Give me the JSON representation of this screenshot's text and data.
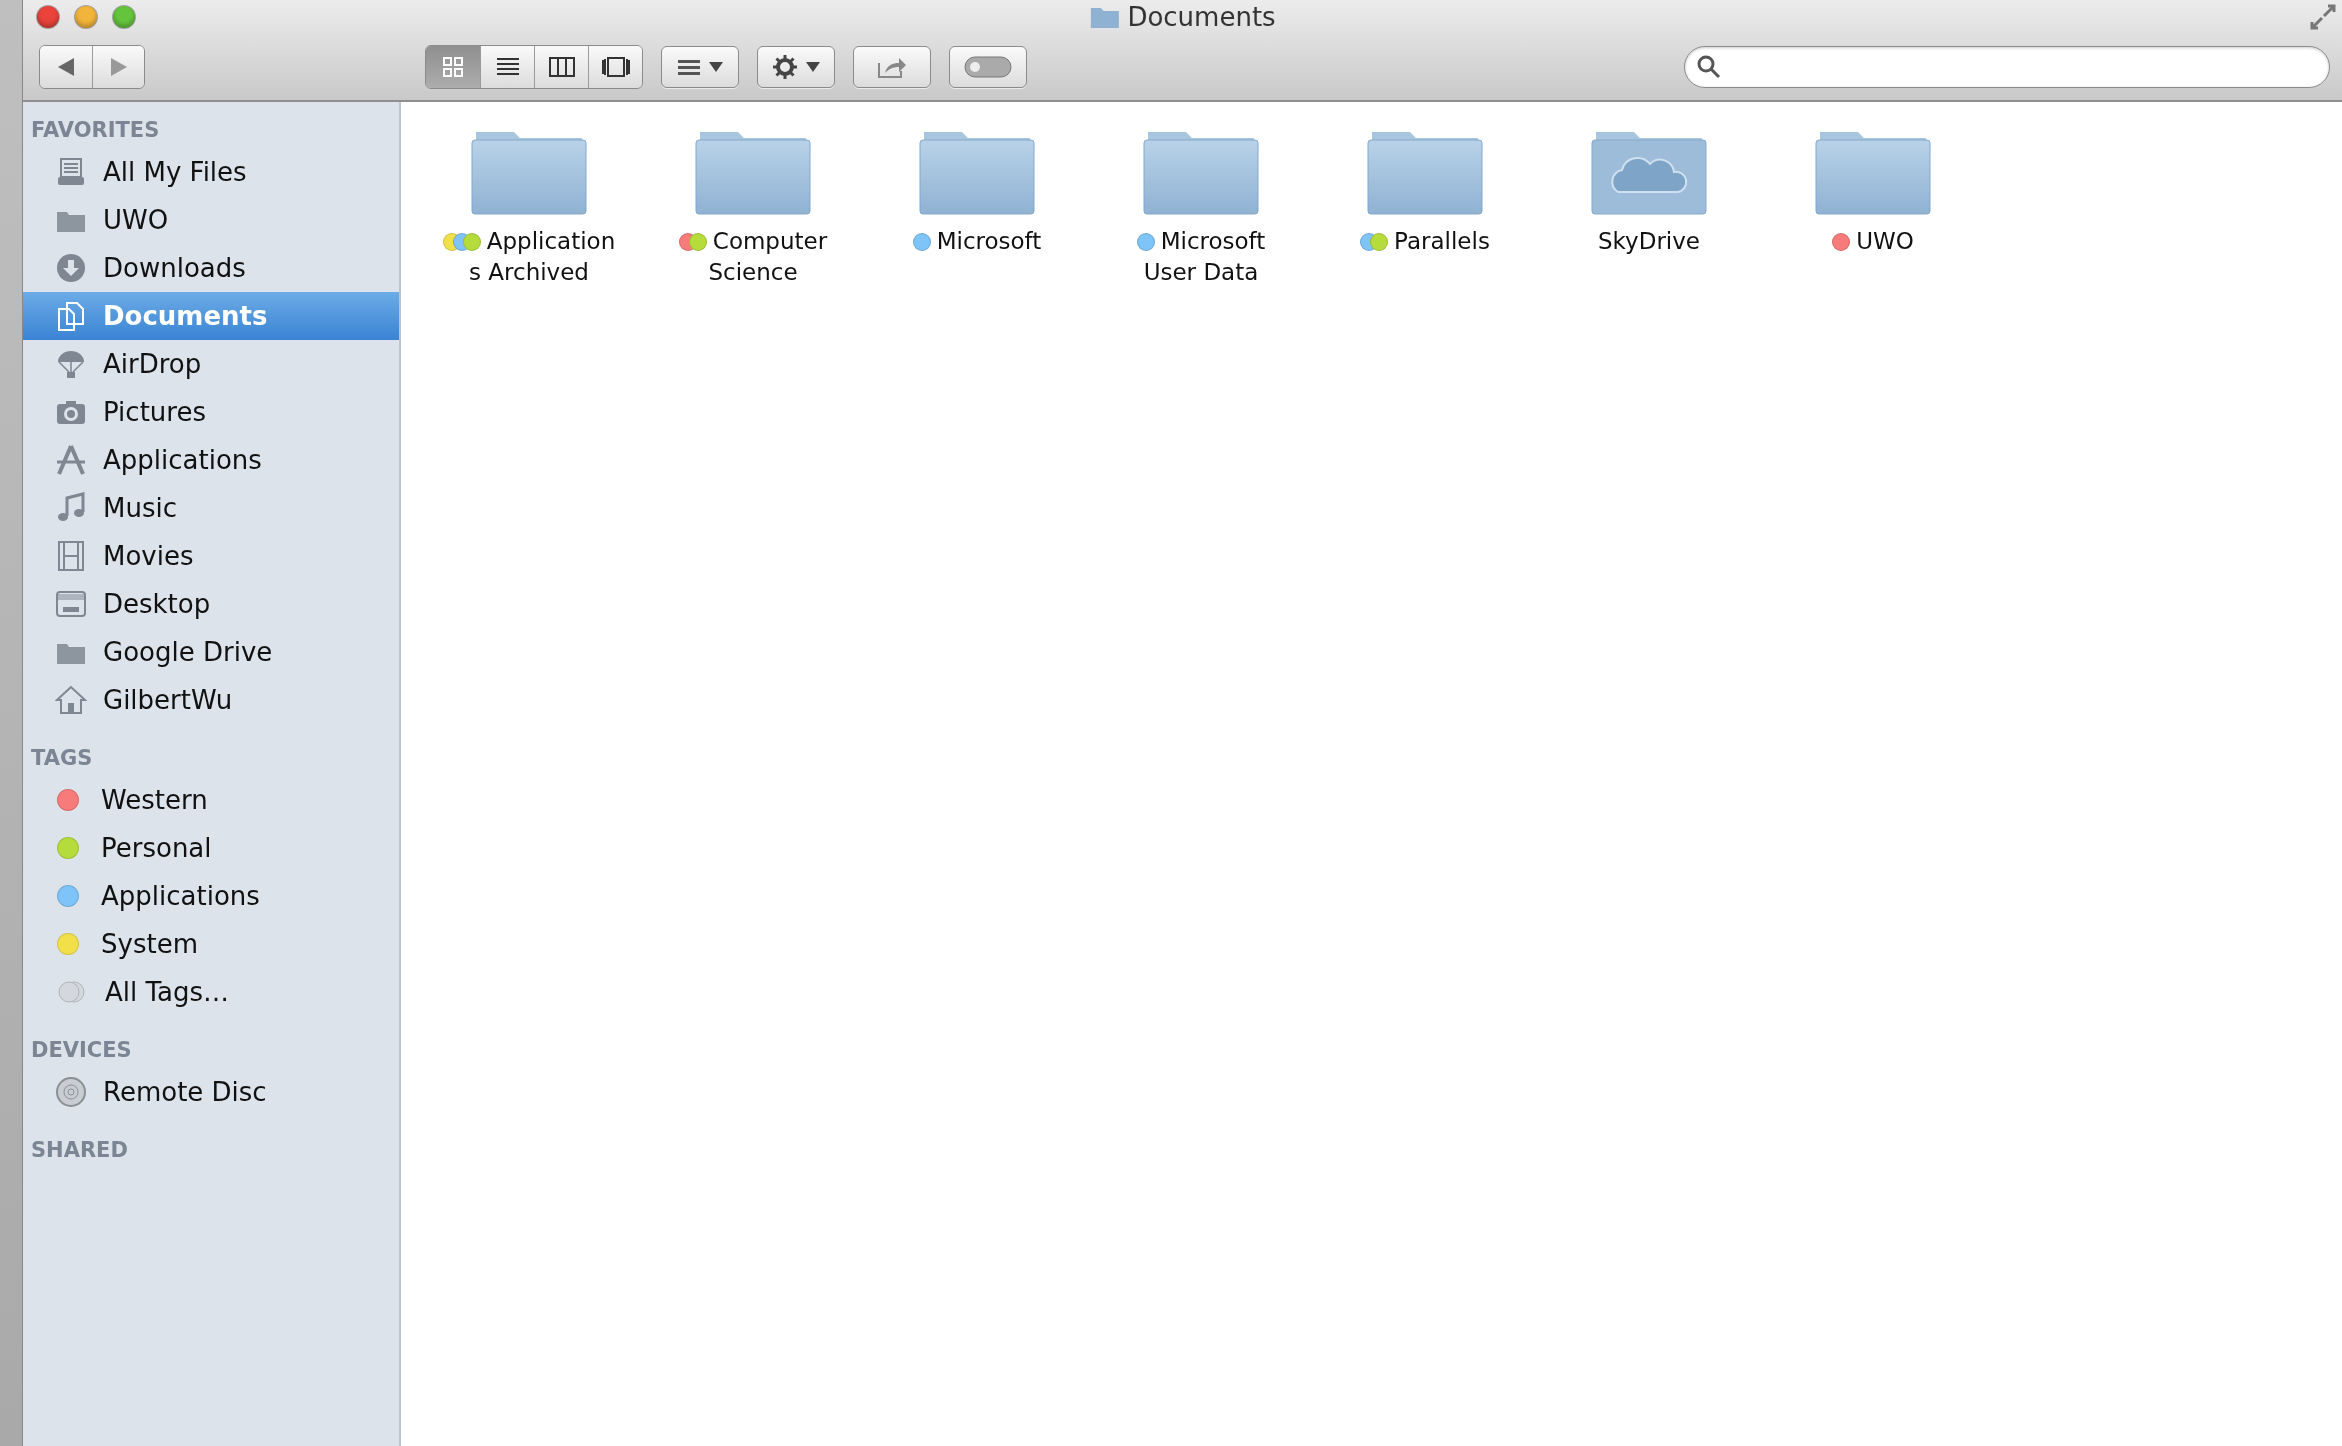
{
  "window": {
    "title": "Documents"
  },
  "toolbar": {
    "views": [
      {
        "kind": "icons",
        "selected": true
      },
      {
        "kind": "list",
        "selected": false
      },
      {
        "kind": "columns",
        "selected": false
      },
      {
        "kind": "coverflow",
        "selected": false
      }
    ]
  },
  "sidebar": {
    "sections": [
      {
        "title": "FAVORITES",
        "items": [
          {
            "kind": "files",
            "label": "All My Files",
            "selected": false
          },
          {
            "kind": "folder",
            "label": "UWO",
            "selected": false
          },
          {
            "kind": "download",
            "label": "Downloads",
            "selected": false
          },
          {
            "kind": "documents",
            "label": "Documents",
            "selected": true
          },
          {
            "kind": "airdrop",
            "label": "AirDrop",
            "selected": false
          },
          {
            "kind": "camera",
            "label": "Pictures",
            "selected": false
          },
          {
            "kind": "apps",
            "label": "Applications",
            "selected": false
          },
          {
            "kind": "music",
            "label": "Music",
            "selected": false
          },
          {
            "kind": "movies",
            "label": "Movies",
            "selected": false
          },
          {
            "kind": "desktop",
            "label": "Desktop",
            "selected": false
          },
          {
            "kind": "folder",
            "label": "Google Drive",
            "selected": false
          },
          {
            "kind": "home",
            "label": "GilbertWu",
            "selected": false
          }
        ]
      },
      {
        "title": "TAGS",
        "items": [
          {
            "kind": "tag",
            "label": "Western",
            "color": "#f77b7b",
            "selected": false
          },
          {
            "kind": "tag",
            "label": "Personal",
            "color": "#b6dc3c",
            "selected": false
          },
          {
            "kind": "tag",
            "label": "Applications",
            "color": "#7ec4f8",
            "selected": false
          },
          {
            "kind": "tag",
            "label": "System",
            "color": "#f2e04a",
            "selected": false
          },
          {
            "kind": "alltags",
            "label": "All Tags…",
            "selected": false
          }
        ]
      },
      {
        "title": "DEVICES",
        "items": [
          {
            "kind": "disc",
            "label": "Remote Disc",
            "selected": false
          }
        ]
      },
      {
        "title": "SHARED"
      }
    ]
  },
  "files": [
    {
      "kind": "folder",
      "name": "Application",
      "name_line_2": "s Archived",
      "tags": [
        {
          "color": "#f2e04a"
        },
        {
          "color": "#7ec4f8"
        },
        {
          "color": "#b6dc3c"
        }
      ]
    },
    {
      "kind": "folder",
      "name": "Computer",
      "name_line_2": "Science",
      "tags": [
        {
          "color": "#f77b7b"
        },
        {
          "color": "#b6dc3c"
        }
      ]
    },
    {
      "kind": "folder",
      "name": "Microsoft",
      "tags": [
        {
          "color": "#7ec4f8"
        }
      ]
    },
    {
      "kind": "folder",
      "name": "Microsoft",
      "name_line_2": "User Data",
      "tags": [
        {
          "color": "#7ec4f8"
        }
      ]
    },
    {
      "kind": "folder",
      "name": "Parallels",
      "tags": [
        {
          "color": "#7ec4f8"
        },
        {
          "color": "#b6dc3c"
        }
      ]
    },
    {
      "kind": "cloud",
      "name": "SkyDrive"
    },
    {
      "kind": "folder",
      "name": "UWO",
      "tags": [
        {
          "color": "#f77b7b"
        }
      ]
    }
  ]
}
